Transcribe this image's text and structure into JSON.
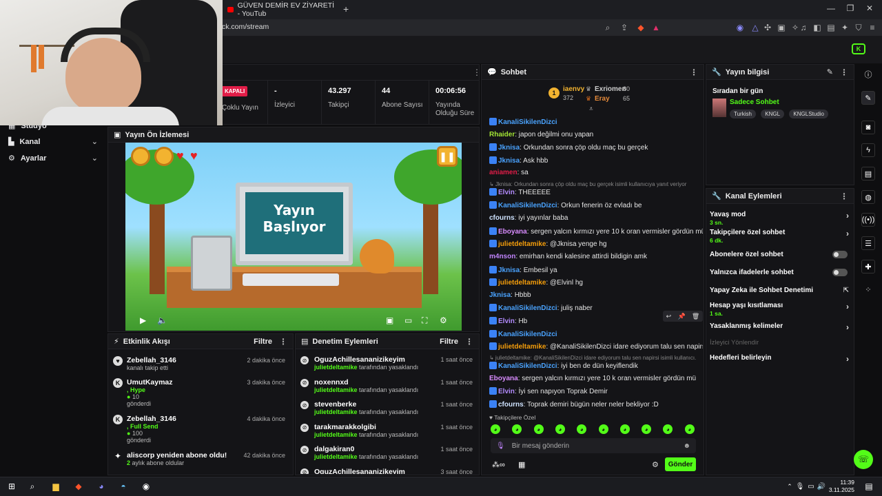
{
  "browser": {
    "tab_title": "GÜVEN DEMİR EV ZİYARETİ - YouTub",
    "new_tab": "+",
    "url": "ck.com/stream"
  },
  "sidebar": {
    "items": [
      {
        "label": "Stüdyo"
      },
      {
        "label": "Kanal"
      },
      {
        "label": "Ayarlar"
      }
    ]
  },
  "stats": {
    "status_badge": "KAPALI",
    "status_label": "Çoklu Yayın",
    "viewers_value": "-",
    "viewers_label": "İzleyici",
    "followers_value": "43.297",
    "followers_label": "Takipçi",
    "subs_value": "44",
    "subs_label": "Abone Sayısı",
    "uptime_value": "00:06:56",
    "uptime_label_1": "Yayında",
    "uptime_label_2": "Olduğu Süre"
  },
  "preview": {
    "title": "Yayın Ön İzlemesi",
    "screen_line1": "Yayın",
    "screen_line2": "Başlıyor"
  },
  "activity": {
    "title": "Etkinlik Akışı",
    "filter": "Filtre",
    "items": [
      {
        "name": "Zebellah_3146",
        "sub": "kanalı takip etti",
        "time": "2 dakika önce"
      },
      {
        "name": "UmutKaymaz",
        "gift": ", Hype",
        "amount": "10",
        "sub": "gönderdi",
        "time": "3 dakika önce"
      },
      {
        "name": "Zebellah_3146",
        "gift": ", Full Send",
        "amount": "100",
        "sub": "gönderdi",
        "time": "4 dakika önce"
      },
      {
        "name": "aliscorp yeniden abone oldu!",
        "months": "2",
        "sub": "aylık abone oldular",
        "time": "42 dakika önce"
      }
    ]
  },
  "moderation": {
    "title": "Denetim Eylemleri",
    "filter": "Filtre",
    "by": "julietdeltamike",
    "action": "tarafından yasaklandı",
    "items": [
      {
        "name": "OguzAchillesananizikeyim",
        "time": "1 saat önce"
      },
      {
        "name": "noxennxd",
        "time": "1 saat önce"
      },
      {
        "name": "stevenberke",
        "time": "1 saat önce"
      },
      {
        "name": "tarakmarakkolgibi",
        "time": "1 saat önce"
      },
      {
        "name": "dalgakiran0",
        "time": "1 saat önce"
      },
      {
        "name": "OguzAchillesananizikeyim",
        "time": "3 saat önce"
      }
    ]
  },
  "chat": {
    "title": "Sohbet",
    "leader_rank": "1",
    "leader1_name": "iaenvy",
    "leader1_score": "372",
    "leader2_name": "Exriomen",
    "leader2_score": "80",
    "leader3_name": "Eray",
    "leader3_score": "65",
    "messages": [
      {
        "user": "KanaliSikilenDizci",
        "text": "",
        "color": "#4aa3ff"
      },
      {
        "user": "Rhaider",
        "text": ": japon değilmi onu yapan",
        "color": "#a3e635"
      },
      {
        "user": "Jknisa",
        "text": ": Orkundan sonra çöp oldu maç bu gerçek",
        "color": "#4aa3ff"
      },
      {
        "user": "Jknisa",
        "text": ": Ask hbb",
        "color": "#4aa3ff"
      },
      {
        "user": "aniamen",
        "text": ": sa",
        "color": "#e11d48"
      },
      {
        "user": "Elvin",
        "text": ": THEEEEE",
        "color": "#b48cff"
      },
      {
        "user": "KanaliSikilenDizci",
        "text": ": Orkun fenerin öz evladı be",
        "color": "#4aa3ff"
      },
      {
        "user": "cfourns",
        "text": ": iyi yayınlar baba",
        "color": "#cfe3ff"
      },
      {
        "user": "Eboyana",
        "text": ": sergen yalcın kırmızı yere 10 k oran vermisler gördün mü",
        "color": "#d98cff"
      },
      {
        "user": "julietdeltamike",
        "text": ": @Jknisa yenge hg",
        "color": "#f59e0b"
      },
      {
        "user": "m4nson",
        "text": ": emirhan kendi kalesine attirdi bildigin amk",
        "color": "#c084fc"
      },
      {
        "user": "Jknisa",
        "text": ": Embesil ya",
        "color": "#4aa3ff"
      },
      {
        "user": "julietdeltamike",
        "text": ": @Elvinl hg",
        "color": "#f59e0b"
      },
      {
        "user": "Jknisa",
        "text": ": Hbbb",
        "color": "#4aa3ff"
      },
      {
        "user": "KanaliSikilenDizci",
        "text": ": juliş naber",
        "color": "#4aa3ff"
      },
      {
        "user": "Elvin",
        "text": ": Hb",
        "color": "#b48cff"
      },
      {
        "user": "KanaliSikilenDizci",
        "text": "",
        "color": "#4aa3ff"
      },
      {
        "user": "julietdeltamike",
        "text": ": @KanaliSikilenDizci idare ediyorum talu sen napirsi",
        "color": "#f59e0b"
      },
      {
        "user": "KanaliSikilenDizci",
        "text": ": iyi ben de dün keyiflendik",
        "color": "#4aa3ff"
      },
      {
        "user": "Eboyana",
        "text": ": sergen yalcın kırmızı yere 10 k oran vermisler gördün mü",
        "color": "#d98cff"
      },
      {
        "user": "Elvin",
        "text": ": İyi sen napıyon Toprak Demir",
        "color": "#b48cff"
      },
      {
        "user": "cfourns",
        "text": ": Toprak demiri bügün neler neler bekliyor :D",
        "color": "#cfe3ff"
      }
    ],
    "reply1": "↳ Jknisa: Orkundan sonra çöp oldu maç bu gerçek isimli kullanıcıya yanıt veriyor",
    "reply2": "↳ julietdeltamike: @KanaliSikilenDizci idare ediyorum talu sen napirsi isimli kullanıcı...",
    "followers_only": "♥ Takipçilere Özel",
    "input_placeholder": "Bir mesaj gönderin",
    "send": "Gönder"
  },
  "stream_info": {
    "title": "Yayın bilgisi",
    "stream_title": "Sıradan bir gün",
    "category": "Sadece Sohbet",
    "tags": [
      "Turkish",
      "KNGL",
      "KNGLStudio"
    ]
  },
  "channel_actions": {
    "title": "Kanal Eylemleri",
    "slow_mode": "Yavaş mod",
    "slow_mode_value": "3 sn.",
    "followers_chat": "Takipçilere özel sohbet",
    "followers_chat_value": "6 dk.",
    "subs_chat": "Abonelere özel sohbet",
    "emotes_chat": "Yalnızca ifadelerle sohbet",
    "ai_mod": "Yapay Zeka ile Sohbet Denetimi",
    "age_restrict": "Hesap yaşı kısıtlaması",
    "age_restrict_value": "1 sa.",
    "banned_words": "Yasaklanmış kelimeler",
    "redirect": "İzleyici Yönlendir",
    "goals": "Hedefleri belirleyin"
  },
  "taskbar": {
    "time": "11:39",
    "date": "3.11.2025"
  }
}
